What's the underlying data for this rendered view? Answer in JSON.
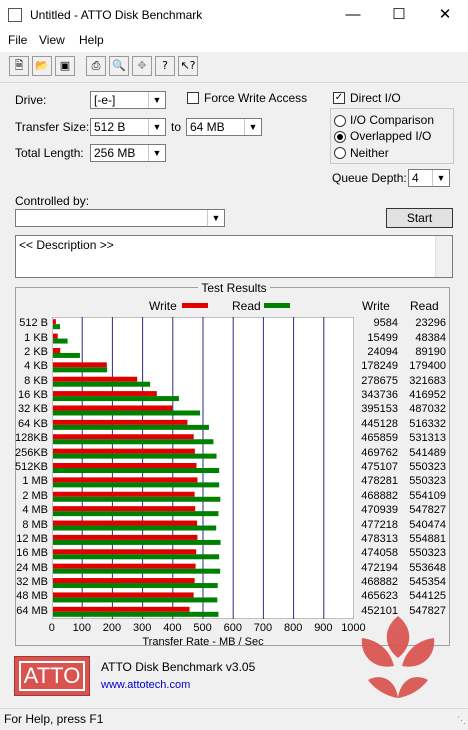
{
  "window": {
    "title": "Untitled - ATTO Disk Benchmark"
  },
  "menu": [
    "File",
    "View",
    "Help"
  ],
  "toolbar": {
    "icons": [
      "new-icon",
      "open-icon",
      "save-icon",
      "print-icon",
      "print-preview-icon",
      "move-icon",
      "help-icon",
      "context-help-icon"
    ]
  },
  "settings": {
    "drive_label": "Drive:",
    "drive_value": "[-e-]",
    "transfer_size_label": "Transfer Size:",
    "transfer_from": "512 B",
    "to_label": "to",
    "transfer_to": "64 MB",
    "total_length_label": "Total Length:",
    "total_length_value": "256 MB",
    "force_write_label": "Force Write Access",
    "force_write_checked": false,
    "direct_io_label": "Direct I/O",
    "direct_io_checked": true,
    "io_options": [
      {
        "label": "I/O Comparison",
        "selected": false
      },
      {
        "label": "Overlapped I/O",
        "selected": true
      },
      {
        "label": "Neither",
        "selected": false
      }
    ],
    "queue_depth_label": "Queue Depth:",
    "queue_depth_value": "4",
    "controlled_by_label": "Controlled by:",
    "controlled_by_value": "",
    "start_button": "Start",
    "description": "<< Description >>"
  },
  "results": {
    "title": "Test Results",
    "write_col": "Write",
    "read_col": "Read"
  },
  "chart_data": {
    "type": "bar",
    "orientation": "horizontal",
    "title": "Test Results",
    "xlabel": "Transfer Rate - MB / Sec",
    "xlim": [
      0,
      1000
    ],
    "xticks": [
      "0",
      "100",
      "200",
      "300",
      "400",
      "500",
      "600",
      "700",
      "800",
      "900",
      "1000"
    ],
    "grid": true,
    "legend": "top",
    "categories": [
      "512 B",
      "1 KB",
      "2 KB",
      "4 KB",
      "8 KB",
      "16 KB",
      "32 KB",
      "64 KB",
      "128KB",
      "256KB",
      "512KB",
      "1 MB",
      "2 MB",
      "4 MB",
      "8 MB",
      "12 MB",
      "16 MB",
      "24 MB",
      "32 MB",
      "48 MB",
      "64 MB"
    ],
    "series": [
      {
        "name": "Write",
        "color": "#e00000",
        "values": [
          9584,
          15499,
          24094,
          178249,
          278675,
          343736,
          395153,
          445128,
          465859,
          469762,
          475107,
          478281,
          468882,
          470939,
          477218,
          478313,
          474058,
          472194,
          468882,
          465623,
          452101
        ]
      },
      {
        "name": "Read",
        "color": "#008000",
        "values": [
          23296,
          48384,
          89190,
          179400,
          321683,
          416952,
          487032,
          516332,
          531313,
          541489,
          550323,
          550323,
          554109,
          547827,
          540474,
          554881,
          550323,
          553648,
          545354,
          544125,
          547827
        ]
      }
    ]
  },
  "footer": {
    "logo": "ATTO",
    "product": "ATTO Disk Benchmark v3.05",
    "url": "www.attotech.com"
  },
  "status": "For Help, press F1",
  "colors": {
    "write": "#e00000",
    "read": "#008000",
    "logo_bg": "#d9534f",
    "link": "#0000cc"
  }
}
